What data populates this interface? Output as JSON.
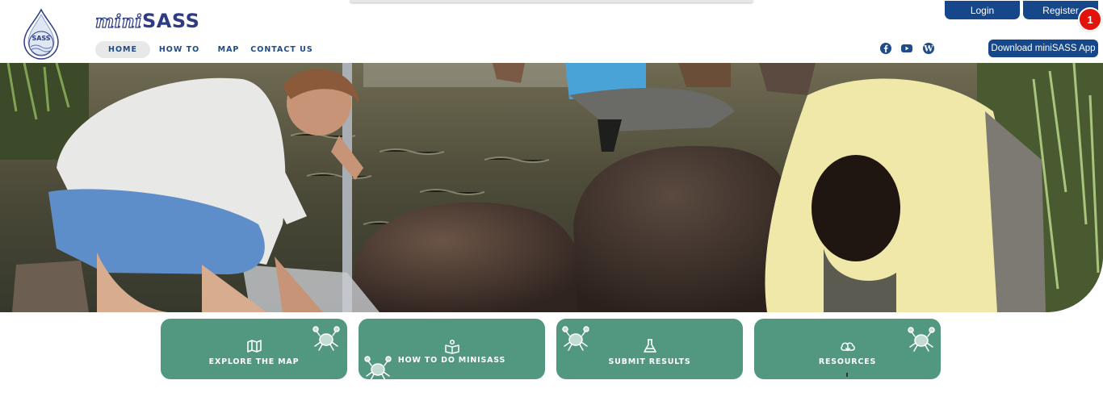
{
  "brand": {
    "name_part1": "mini",
    "name_part2": "SASS",
    "logo_text": "SASS"
  },
  "nav": {
    "items": [
      {
        "label": "HOME",
        "active": true
      },
      {
        "label": "HOW TO",
        "active": false
      },
      {
        "label": "MAP",
        "active": false
      },
      {
        "label": "CONTACT US",
        "active": false
      }
    ]
  },
  "social": [
    {
      "icon": "facebook-icon"
    },
    {
      "icon": "youtube-icon"
    },
    {
      "icon": "wordpress-icon"
    }
  ],
  "auth": {
    "login_label": "Login",
    "register_label": "Register",
    "notification_count": "1"
  },
  "download_label": "Download miniSASS App",
  "cards": [
    {
      "label": "EXPLORE THE MAP",
      "icon": "map-icon"
    },
    {
      "label": "HOW TO DO MINISASS",
      "icon": "book-reader-icon"
    },
    {
      "label": "SUBMIT RESULTS",
      "icon": "flask-icon"
    },
    {
      "label": "RESOURCES",
      "icon": "cloud-download-icon"
    }
  ],
  "colors": {
    "nav_text": "#1e4b8a",
    "button_blue": "#15478a",
    "card_green": "#52977f",
    "badge_red": "#e3120b",
    "brand_navy": "#2d3a84"
  }
}
